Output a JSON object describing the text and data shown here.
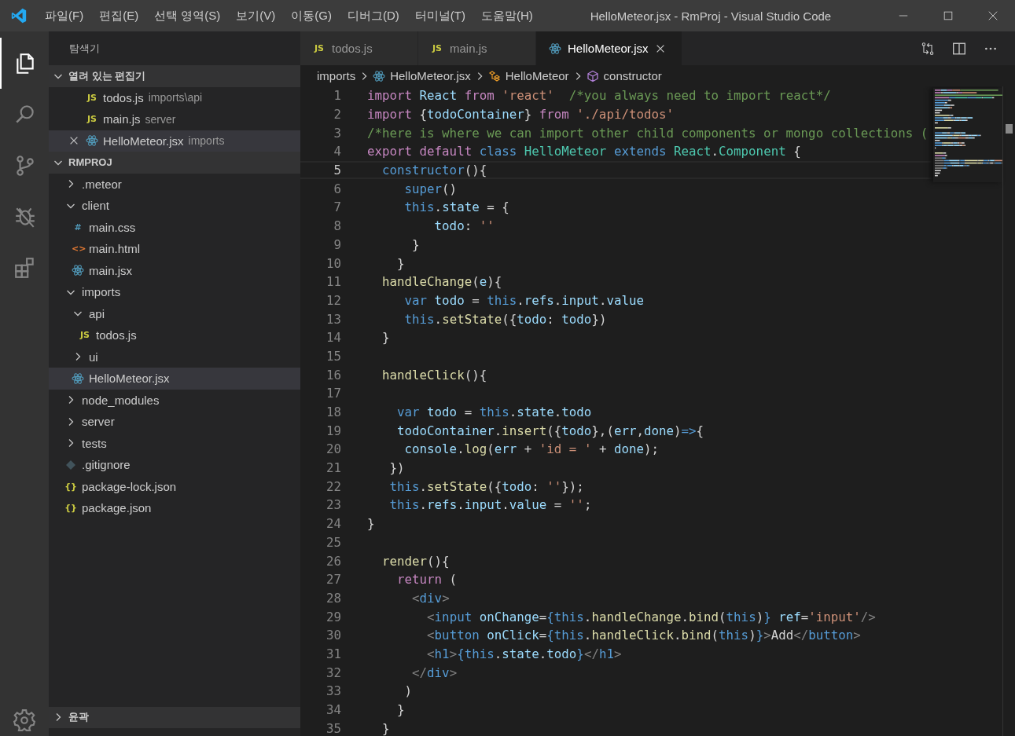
{
  "window": {
    "title": "HelloMeteor.jsx - RmProj - Visual Studio Code"
  },
  "menu": [
    "파일(F)",
    "편집(E)",
    "선택 영역(S)",
    "보기(V)",
    "이동(G)",
    "디버그(D)",
    "터미널(T)",
    "도움말(H)"
  ],
  "activity_bar": [
    {
      "kind": "explorer",
      "selected": true
    },
    {
      "kind": "search",
      "selected": false
    },
    {
      "kind": "scm",
      "selected": false
    },
    {
      "kind": "debug",
      "selected": false
    },
    {
      "kind": "extensions",
      "selected": false
    }
  ],
  "explorer": {
    "title": "탐색기",
    "open_editors": {
      "label": "열려 있는 편집기",
      "expanded": true,
      "items": [
        {
          "name": "todos.js",
          "description": "imports\\api",
          "kind": "js",
          "badge": "JS",
          "selected": false
        },
        {
          "name": "main.js",
          "description": "server",
          "kind": "js",
          "badge": "JS",
          "selected": false
        },
        {
          "name": "HelloMeteor.jsx",
          "description": "imports",
          "kind": "react",
          "selected": true
        }
      ]
    },
    "project": {
      "label": "RMPROJ",
      "expanded": true,
      "children": [
        {
          "name": ".meteor",
          "kind": "folder",
          "expanded": false,
          "selected": false
        },
        {
          "name": "client",
          "kind": "folder",
          "expanded": true,
          "selected": false,
          "children": [
            {
              "name": "main.css",
              "kind": "css",
              "badge": "#",
              "selected": false
            },
            {
              "name": "main.html",
              "kind": "html",
              "badge": "<>",
              "selected": false
            },
            {
              "name": "main.jsx",
              "kind": "react",
              "selected": false
            }
          ]
        },
        {
          "name": "imports",
          "kind": "folder",
          "expanded": true,
          "selected": false,
          "children": [
            {
              "name": "api",
              "kind": "folder",
              "expanded": true,
              "selected": false,
              "children": [
                {
                  "name": "todos.js",
                  "kind": "js",
                  "badge": "JS",
                  "selected": false
                }
              ]
            },
            {
              "name": "ui",
              "kind": "folder",
              "expanded": false,
              "selected": false
            },
            {
              "name": "HelloMeteor.jsx",
              "kind": "react",
              "selected": true
            }
          ]
        },
        {
          "name": "node_modules",
          "kind": "folder",
          "expanded": false,
          "selected": false
        },
        {
          "name": "server",
          "kind": "folder",
          "expanded": false,
          "selected": false
        },
        {
          "name": "tests",
          "kind": "folder",
          "expanded": false,
          "selected": false
        },
        {
          "name": ".gitignore",
          "kind": "git",
          "selected": false
        },
        {
          "name": "package-lock.json",
          "kind": "json",
          "badge": "{}",
          "selected": false
        },
        {
          "name": "package.json",
          "kind": "json",
          "badge": "{}",
          "selected": false
        }
      ]
    },
    "outline": {
      "label": "윤곽",
      "expanded": false
    }
  },
  "tabs": [
    {
      "label": "todos.js",
      "kind": "js",
      "badge": "JS",
      "selected": false
    },
    {
      "label": "main.js",
      "kind": "js",
      "badge": "JS",
      "selected": false
    },
    {
      "label": "HelloMeteor.jsx",
      "kind": "react",
      "selected": true
    }
  ],
  "breadcrumbs": [
    {
      "label": "imports",
      "kind": "folder"
    },
    {
      "label": "HelloMeteor.jsx",
      "kind": "react"
    },
    {
      "label": "HelloMeteor",
      "kind": "class"
    },
    {
      "label": "constructor",
      "kind": "method"
    }
  ],
  "code": [
    {
      "number": "1",
      "current": false,
      "tokens": [
        {
          "kind": "kw",
          "text": "import"
        },
        {
          "kind": "var",
          "text": " React"
        },
        {
          "kind": "kw",
          "text": " from"
        },
        {
          "kind": "str",
          "text": " 'react'"
        },
        {
          "kind": "com",
          "text": "  /*you always need to import react*/"
        }
      ]
    },
    {
      "number": "2",
      "current": false,
      "tokens": [
        {
          "kind": "kw",
          "text": "import"
        },
        {
          "kind": "p",
          "text": " {"
        },
        {
          "kind": "var",
          "text": "todoContainer"
        },
        {
          "kind": "p",
          "text": "} "
        },
        {
          "kind": "kw",
          "text": "from"
        },
        {
          "kind": "str",
          "text": " './api/todos'"
        }
      ]
    },
    {
      "number": "3",
      "current": false,
      "tokens": [
        {
          "kind": "com",
          "text": "/*here is where we can import other child components or mongo collections ("
        }
      ]
    },
    {
      "number": "4",
      "current": false,
      "tokens": [
        {
          "kind": "kw",
          "text": "export default"
        },
        {
          "kind": "st",
          "text": " class"
        },
        {
          "kind": "type",
          "text": " HelloMeteor"
        },
        {
          "kind": "st",
          "text": " extends"
        },
        {
          "kind": "type",
          "text": " React"
        },
        {
          "kind": "p",
          "text": "."
        },
        {
          "kind": "type",
          "text": "Component"
        },
        {
          "kind": "p",
          "text": " {"
        }
      ]
    },
    {
      "number": "5",
      "current": true,
      "tokens": [
        {
          "kind": "st",
          "text": "  constructor"
        },
        {
          "kind": "p",
          "text": "(){"
        }
      ]
    },
    {
      "number": "6",
      "current": false,
      "tokens": [
        {
          "kind": "st",
          "text": "     super"
        },
        {
          "kind": "p",
          "text": "()"
        }
      ]
    },
    {
      "number": "7",
      "current": false,
      "tokens": [
        {
          "kind": "st",
          "text": "     this"
        },
        {
          "kind": "p",
          "text": "."
        },
        {
          "kind": "var",
          "text": "state"
        },
        {
          "kind": "p",
          "text": " = {"
        }
      ]
    },
    {
      "number": "8",
      "current": false,
      "tokens": [
        {
          "kind": "var",
          "text": "         todo"
        },
        {
          "kind": "p",
          "text": ": "
        },
        {
          "kind": "str",
          "text": "''"
        }
      ]
    },
    {
      "number": "9",
      "current": false,
      "tokens": [
        {
          "kind": "p",
          "text": "      }"
        }
      ]
    },
    {
      "number": "10",
      "current": false,
      "tokens": [
        {
          "kind": "p",
          "text": "    }"
        }
      ]
    },
    {
      "number": "11",
      "current": false,
      "tokens": [
        {
          "kind": "fn",
          "text": "  handleChange"
        },
        {
          "kind": "p",
          "text": "("
        },
        {
          "kind": "var",
          "text": "e"
        },
        {
          "kind": "p",
          "text": "){"
        }
      ]
    },
    {
      "number": "12",
      "current": false,
      "tokens": [
        {
          "kind": "st",
          "text": "     var"
        },
        {
          "kind": "var",
          "text": " todo"
        },
        {
          "kind": "p",
          "text": " = "
        },
        {
          "kind": "st",
          "text": "this"
        },
        {
          "kind": "p",
          "text": "."
        },
        {
          "kind": "var",
          "text": "refs"
        },
        {
          "kind": "p",
          "text": "."
        },
        {
          "kind": "var",
          "text": "input"
        },
        {
          "kind": "p",
          "text": "."
        },
        {
          "kind": "var",
          "text": "value"
        }
      ]
    },
    {
      "number": "13",
      "current": false,
      "tokens": [
        {
          "kind": "st",
          "text": "     this"
        },
        {
          "kind": "p",
          "text": "."
        },
        {
          "kind": "fn",
          "text": "setState"
        },
        {
          "kind": "p",
          "text": "({"
        },
        {
          "kind": "var",
          "text": "todo"
        },
        {
          "kind": "p",
          "text": ": "
        },
        {
          "kind": "var",
          "text": "todo"
        },
        {
          "kind": "p",
          "text": "})"
        }
      ]
    },
    {
      "number": "14",
      "current": false,
      "tokens": [
        {
          "kind": "p",
          "text": "  }"
        }
      ]
    },
    {
      "number": "15",
      "current": false
    },
    {
      "number": "16",
      "current": false,
      "tokens": [
        {
          "kind": "fn",
          "text": "  handleClick"
        },
        {
          "kind": "p",
          "text": "(){"
        }
      ]
    },
    {
      "number": "17",
      "current": false
    },
    {
      "number": "18",
      "current": false,
      "tokens": [
        {
          "kind": "st",
          "text": "    var"
        },
        {
          "kind": "var",
          "text": " todo"
        },
        {
          "kind": "p",
          "text": " = "
        },
        {
          "kind": "st",
          "text": "this"
        },
        {
          "kind": "p",
          "text": "."
        },
        {
          "kind": "var",
          "text": "state"
        },
        {
          "kind": "p",
          "text": "."
        },
        {
          "kind": "var",
          "text": "todo"
        }
      ]
    },
    {
      "number": "19",
      "current": false,
      "tokens": [
        {
          "kind": "var",
          "text": "    todoContainer"
        },
        {
          "kind": "p",
          "text": "."
        },
        {
          "kind": "fn",
          "text": "insert"
        },
        {
          "kind": "p",
          "text": "({"
        },
        {
          "kind": "var",
          "text": "todo"
        },
        {
          "kind": "p",
          "text": "},("
        },
        {
          "kind": "var",
          "text": "err"
        },
        {
          "kind": "p",
          "text": ","
        },
        {
          "kind": "var",
          "text": "done"
        },
        {
          "kind": "p",
          "text": ")"
        },
        {
          "kind": "st",
          "text": "=>"
        },
        {
          "kind": "p",
          "text": "{"
        }
      ]
    },
    {
      "number": "20",
      "current": false,
      "tokens": [
        {
          "kind": "var",
          "text": "     console"
        },
        {
          "kind": "p",
          "text": "."
        },
        {
          "kind": "fn",
          "text": "log"
        },
        {
          "kind": "p",
          "text": "("
        },
        {
          "kind": "var",
          "text": "err"
        },
        {
          "kind": "p",
          "text": " + "
        },
        {
          "kind": "str",
          "text": "'id = '"
        },
        {
          "kind": "p",
          "text": " + "
        },
        {
          "kind": "var",
          "text": "done"
        },
        {
          "kind": "p",
          "text": ");"
        }
      ]
    },
    {
      "number": "21",
      "current": false,
      "tokens": [
        {
          "kind": "p",
          "text": "   })"
        }
      ]
    },
    {
      "number": "22",
      "current": false,
      "tokens": [
        {
          "kind": "st",
          "text": "   this"
        },
        {
          "kind": "p",
          "text": "."
        },
        {
          "kind": "fn",
          "text": "setState"
        },
        {
          "kind": "p",
          "text": "({"
        },
        {
          "kind": "var",
          "text": "todo"
        },
        {
          "kind": "p",
          "text": ": "
        },
        {
          "kind": "str",
          "text": "''"
        },
        {
          "kind": "p",
          "text": "});"
        }
      ]
    },
    {
      "number": "23",
      "current": false,
      "tokens": [
        {
          "kind": "st",
          "text": "   this"
        },
        {
          "kind": "p",
          "text": "."
        },
        {
          "kind": "var",
          "text": "refs"
        },
        {
          "kind": "p",
          "text": "."
        },
        {
          "kind": "var",
          "text": "input"
        },
        {
          "kind": "p",
          "text": "."
        },
        {
          "kind": "var",
          "text": "value"
        },
        {
          "kind": "p",
          "text": " = "
        },
        {
          "kind": "str",
          "text": "''"
        },
        {
          "kind": "p",
          "text": ";"
        }
      ]
    },
    {
      "number": "24",
      "current": false,
      "tokens": [
        {
          "kind": "p",
          "text": "}"
        }
      ]
    },
    {
      "number": "25",
      "current": false
    },
    {
      "number": "26",
      "current": false,
      "tokens": [
        {
          "kind": "fn",
          "text": "  render"
        },
        {
          "kind": "p",
          "text": "(){"
        }
      ]
    },
    {
      "number": "27",
      "current": false,
      "tokens": [
        {
          "kind": "kw",
          "text": "    return"
        },
        {
          "kind": "p",
          "text": " ("
        }
      ]
    },
    {
      "number": "28",
      "current": false,
      "tokens": [
        {
          "kind": "ang",
          "text": "      <"
        },
        {
          "kind": "tag",
          "text": "div"
        },
        {
          "kind": "ang",
          "text": ">"
        }
      ]
    },
    {
      "number": "29",
      "current": false,
      "tokens": [
        {
          "kind": "ang",
          "text": "        <"
        },
        {
          "kind": "tag",
          "text": "input"
        },
        {
          "kind": "var",
          "text": " onChange"
        },
        {
          "kind": "p",
          "text": "="
        },
        {
          "kind": "st",
          "text": "{"
        },
        {
          "kind": "st",
          "text": "this"
        },
        {
          "kind": "p",
          "text": "."
        },
        {
          "kind": "fn",
          "text": "handleChange"
        },
        {
          "kind": "p",
          "text": "."
        },
        {
          "kind": "fn",
          "text": "bind"
        },
        {
          "kind": "p",
          "text": "("
        },
        {
          "kind": "st",
          "text": "this"
        },
        {
          "kind": "p",
          "text": ")"
        },
        {
          "kind": "st",
          "text": "}"
        },
        {
          "kind": "var",
          "text": " ref"
        },
        {
          "kind": "p",
          "text": "="
        },
        {
          "kind": "str",
          "text": "'input'"
        },
        {
          "kind": "ang",
          "text": "/>"
        }
      ]
    },
    {
      "number": "30",
      "current": false,
      "tokens": [
        {
          "kind": "ang",
          "text": "        <"
        },
        {
          "kind": "tag",
          "text": "button"
        },
        {
          "kind": "var",
          "text": " onClick"
        },
        {
          "kind": "p",
          "text": "="
        },
        {
          "kind": "st",
          "text": "{"
        },
        {
          "kind": "st",
          "text": "this"
        },
        {
          "kind": "p",
          "text": "."
        },
        {
          "kind": "fn",
          "text": "handleClick"
        },
        {
          "kind": "p",
          "text": "."
        },
        {
          "kind": "fn",
          "text": "bind"
        },
        {
          "kind": "p",
          "text": "("
        },
        {
          "kind": "st",
          "text": "this"
        },
        {
          "kind": "p",
          "text": ")"
        },
        {
          "kind": "st",
          "text": "}"
        },
        {
          "kind": "ang",
          "text": ">"
        },
        {
          "kind": "p",
          "text": "Add"
        },
        {
          "kind": "ang",
          "text": "</"
        },
        {
          "kind": "tag",
          "text": "button"
        },
        {
          "kind": "ang",
          "text": ">"
        }
      ]
    },
    {
      "number": "31",
      "current": false,
      "tokens": [
        {
          "kind": "ang",
          "text": "        <"
        },
        {
          "kind": "tag",
          "text": "h1"
        },
        {
          "kind": "ang",
          "text": ">"
        },
        {
          "kind": "st",
          "text": "{"
        },
        {
          "kind": "st",
          "text": "this"
        },
        {
          "kind": "p",
          "text": "."
        },
        {
          "kind": "var",
          "text": "state"
        },
        {
          "kind": "p",
          "text": "."
        },
        {
          "kind": "var",
          "text": "todo"
        },
        {
          "kind": "st",
          "text": "}"
        },
        {
          "kind": "ang",
          "text": "</"
        },
        {
          "kind": "tag",
          "text": "h1"
        },
        {
          "kind": "ang",
          "text": ">"
        }
      ]
    },
    {
      "number": "32",
      "current": false,
      "tokens": [
        {
          "kind": "ang",
          "text": "      </"
        },
        {
          "kind": "tag",
          "text": "div"
        },
        {
          "kind": "ang",
          "text": ">"
        }
      ]
    },
    {
      "number": "33",
      "current": false,
      "tokens": [
        {
          "kind": "p",
          "text": "     )"
        }
      ]
    },
    {
      "number": "34",
      "current": false,
      "tokens": [
        {
          "kind": "p",
          "text": "    }"
        }
      ]
    },
    {
      "number": "35",
      "current": false,
      "tokens": [
        {
          "kind": "p",
          "text": "  }"
        }
      ]
    }
  ]
}
